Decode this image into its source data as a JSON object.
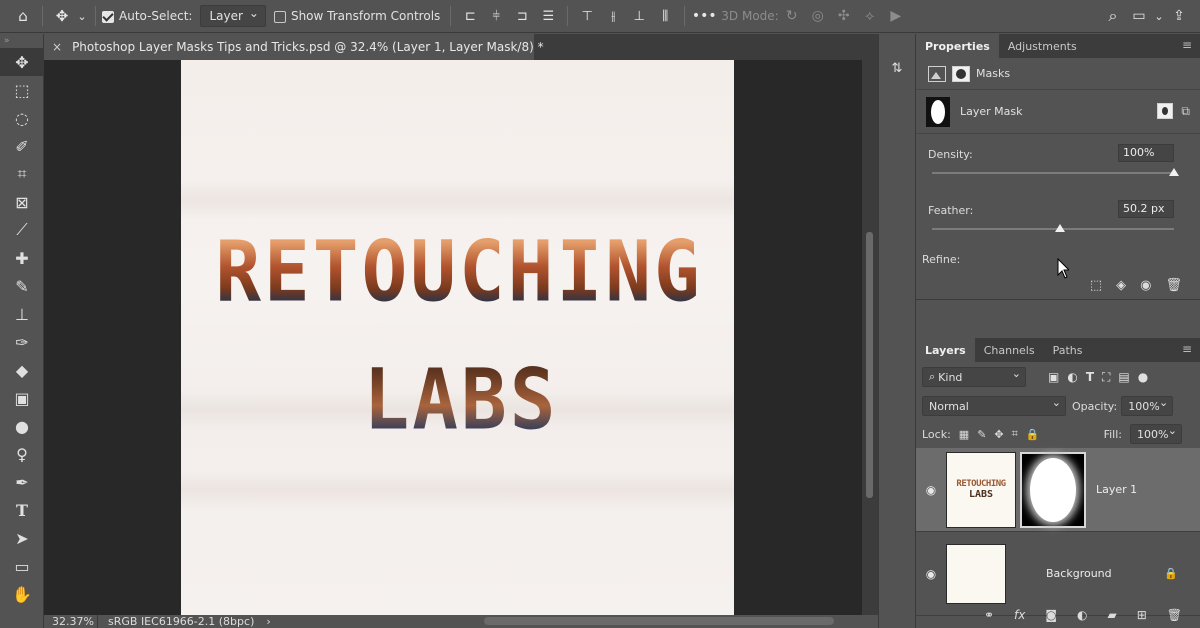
{
  "options_bar": {
    "auto_select_label": "Auto-Select:",
    "auto_select_checked": true,
    "auto_select_target": "Layer",
    "show_transform_label": "Show Transform Controls",
    "show_transform_checked": false,
    "mode_3d_label": "3D Mode:"
  },
  "document": {
    "tab_title": "Photoshop Layer Masks Tips and Tricks.psd @ 32.4% (Layer 1, Layer Mask/8) *",
    "art_line1": "RETOUCHING",
    "art_line2": "LABS"
  },
  "status": {
    "zoom": "32.37%",
    "color_profile": "sRGB IEC61966-2.1 (8bpc)",
    "arrow": "›"
  },
  "properties": {
    "tabs": [
      "Properties",
      "Adjustments"
    ],
    "active_tab": "Properties",
    "section_label": "Masks",
    "mask_title": "Layer Mask",
    "density_label": "Density:",
    "density_value": "100%",
    "density_fraction": 1.0,
    "feather_label": "Feather:",
    "feather_value": "50.2 px",
    "feather_fraction": 0.53,
    "refine_label": "Refine:"
  },
  "layers_panel": {
    "tabs": [
      "Layers",
      "Channels",
      "Paths"
    ],
    "active_tab": "Layers",
    "filter_kind": "Kind",
    "blend_mode": "Normal",
    "opacity_label": "Opacity:",
    "opacity_value": "100%",
    "lock_label": "Lock:",
    "fill_label": "Fill:",
    "fill_value": "100%",
    "layers": [
      {
        "name": "Layer 1",
        "thumb_line1": "RETOUCHING",
        "thumb_line2": "LABS",
        "has_mask": true,
        "selected": true
      },
      {
        "name": "Background",
        "has_mask": false,
        "selected": false,
        "locked": true
      }
    ]
  }
}
